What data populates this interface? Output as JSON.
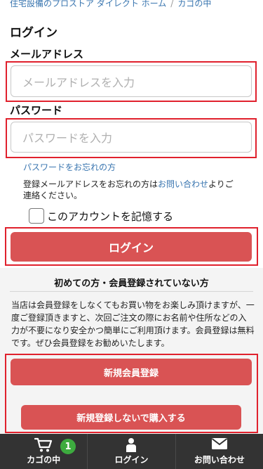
{
  "breadcrumb": {
    "home": "住宅設備のプロストア ダイレクト ホーム",
    "separator": "/",
    "current": "カゴの中"
  },
  "login": {
    "title": "ログイン",
    "email_label": "メールアドレス",
    "email_placeholder": "メールアドレスを入力",
    "password_label": "パスワード",
    "password_placeholder": "パスワードを入力",
    "forgot_password": "パスワードをお忘れの方",
    "email_note_before": "登録メールアドレスをお忘れの方は",
    "email_note_link": "お問い合わせ",
    "email_note_after": "よりご連絡ください。",
    "remember_label": "このアカウントを記憶する",
    "remember_checked": false,
    "login_button": "ログイン"
  },
  "guest": {
    "title": "初めての方・会員登録されていない方",
    "description": "当店は会員登録をしなくてもお買い物をお楽しみ頂けますが、一度ご登録頂きますと、次回ご注文の際にお名前や住所などの入力が不要になり安全かつ簡単にご利用頂けます。会員登録は無料です。ぜひ会員登録をお勧めいたします。",
    "register_button": "新規会員登録",
    "guest_purchase_button": "新規登録しないで購入する"
  },
  "bottom_nav": {
    "cart_label": "カゴの中",
    "cart_count": "1",
    "login_label": "ログイン",
    "contact_label": "お問い合わせ"
  },
  "colors": {
    "accent_red": "#d95354",
    "highlight_red": "#e0212d",
    "link_blue": "#3a76b0",
    "badge_green": "#3dab3f",
    "nav_bg": "#333333"
  },
  "icons": [
    "cart-icon",
    "person-icon",
    "mail-icon"
  ]
}
